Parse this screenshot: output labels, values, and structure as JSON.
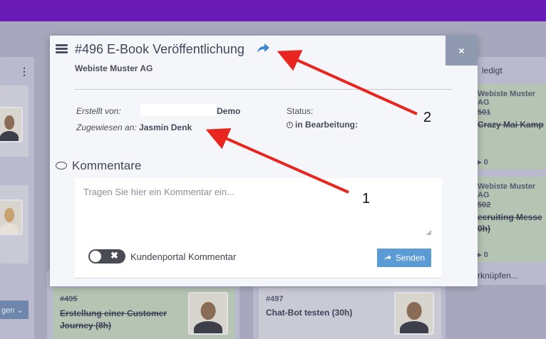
{
  "background": {
    "left_col_menu_icon": "vertical-ellipsis",
    "left_btn_label": "gen",
    "right_col_header": "ledigt",
    "right_cards": [
      {
        "company": "Webiste Muster AG",
        "number": "501",
        "title": "Crazy Mai Kamp",
        "count": "0"
      },
      {
        "company": "Webiste Muster AG",
        "number": "502",
        "title": "ecruiting Messe",
        "title2": "0h)",
        "count": "0"
      }
    ],
    "right_footer": "rknüpfen...",
    "bottom_cards": [
      {
        "number": "#495",
        "title": "Erstellung einer Customer Journey (8h)"
      },
      {
        "number": "#497",
        "title": "Chat-Bot testen (30h)"
      }
    ]
  },
  "modal": {
    "header_icon": "tasks-list-icon",
    "title": "#496 E-Book Veröffentlichung",
    "share_icon": "share-arrow-icon",
    "subtitle": "Webiste Muster AG",
    "close_icon": "×",
    "created_by_label": "Erstellt von:",
    "created_by_value": "Demo",
    "assigned_to_label": "Zugewiesen an:",
    "assigned_to_value": "Jasmin Denk",
    "status_label": "Status:",
    "status_value": "in Bearbeitung:",
    "comments_heading": "Kommentare",
    "comment_placeholder": "Tragen Sie hier ein Kommentar ein...",
    "portal_toggle_label": "Kundenportal Kommentar",
    "portal_toggle_state": "off",
    "send_label": "Senden"
  },
  "annotations": {
    "labels": [
      "1",
      "2"
    ],
    "arrow_color": "#e8261f"
  },
  "colors": {
    "topbar": "#6a1ab5",
    "send_button": "#5b9bd5",
    "close_button": "#8f9ab0"
  }
}
